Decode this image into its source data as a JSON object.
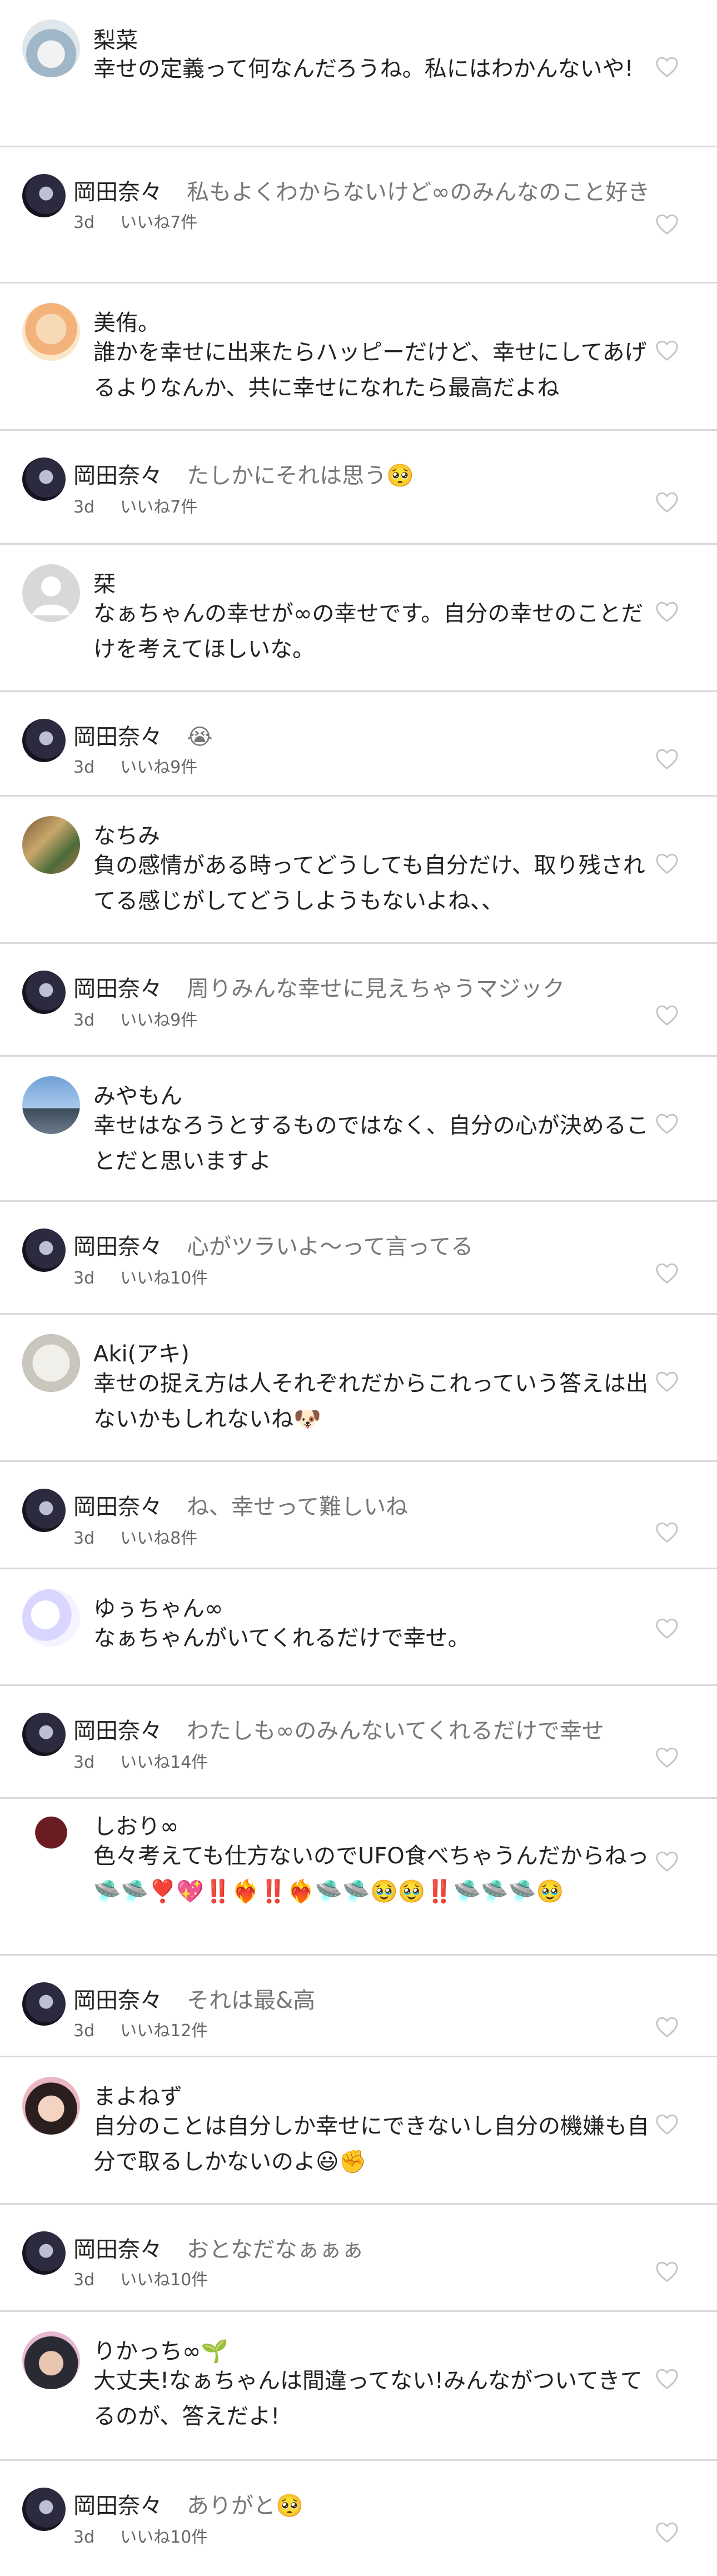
{
  "comments": [
    {
      "type": "comment",
      "name": "梨菜",
      "text": "幸せの定義って何なんだろうね。私にはわかんないや!",
      "avatar": "photo-girl"
    },
    {
      "type": "reply",
      "name": "岡田奈々",
      "text": "私もよくわからないけど∞のみんなのこと好き",
      "time": "3d",
      "likes": "いいね7件"
    },
    {
      "type": "comment",
      "name": "美侑。",
      "text": "誰かを幸せに出来たらハッピーだけど、幸せにしてあげるよりなんか、共に幸せになれたら最高だよね",
      "avatar": "photo-illustration"
    },
    {
      "type": "reply",
      "name": "岡田奈々",
      "text": "たしかにそれは思う🥺",
      "time": "3d",
      "likes": "いいね7件"
    },
    {
      "type": "comment",
      "name": "栞",
      "text": "なぁちゃんの幸せが∞の幸せです。自分の幸せのことだけを考えてほしいな。",
      "avatar": "default-user-icon"
    },
    {
      "type": "reply",
      "name": "岡田奈々",
      "text": "😭",
      "time": "3d",
      "likes": "いいね9件"
    },
    {
      "type": "comment",
      "name": "なちみ",
      "text": "負の感情がある時ってどうしても自分だけ、取り残されてる感じがしてどうしようもないよね、、",
      "avatar": "photo-group"
    },
    {
      "type": "reply",
      "name": "岡田奈々",
      "text": "周りみんな幸せに見えちゃうマジック",
      "time": "3d",
      "likes": "いいね9件"
    },
    {
      "type": "comment",
      "name": "みやもん",
      "text": "幸せはなろうとするものではなく、自分の心が決めることだと思いますよ",
      "avatar": "photo-tower"
    },
    {
      "type": "reply",
      "name": "岡田奈々",
      "text": "心がツラいよ〜って言ってる",
      "time": "3d",
      "likes": "いいね10件"
    },
    {
      "type": "comment",
      "name": "Aki(アキ)",
      "text": "幸せの捉え方は人それぞれだからこれっていう答えは出ないかもしれないね🐶",
      "avatar": "photo-dog"
    },
    {
      "type": "reply",
      "name": "岡田奈々",
      "text": "ね、幸せって難しいね",
      "time": "3d",
      "likes": "いいね8件"
    },
    {
      "type": "comment",
      "name": "ゆぅちゃん∞",
      "text": "なぁちゃんがいてくれるだけで幸せ。",
      "avatar": "photo-moon"
    },
    {
      "type": "reply",
      "name": "岡田奈々",
      "text": "わたしも∞のみんないてくれるだけで幸せ",
      "time": "3d",
      "likes": "いいね14件"
    },
    {
      "type": "comment",
      "name": "しおり∞",
      "text": "色々考えても仕方ないのでUFO食べちゃうんだからねっ🛸🛸❣️💖‼️❤️‍🔥‼️❤️‍🔥🛸🛸🥹🥹‼️🛸🛸🛸🥹",
      "avatar": "photo-pixel-art"
    },
    {
      "type": "reply",
      "name": "岡田奈々",
      "text": "それは最&高",
      "time": "3d",
      "likes": "いいね12件"
    },
    {
      "type": "comment",
      "name": "まよねず",
      "text": "自分のことは自分しか幸せにできないし自分の機嫌も自分で取るしかないのよ😃✊",
      "avatar": "photo-anime"
    },
    {
      "type": "reply",
      "name": "岡田奈々",
      "text": "おとなだなぁぁぁ",
      "time": "3d",
      "likes": "いいね10件"
    },
    {
      "type": "comment",
      "name": "りかっち∞🌱",
      "text": "大丈夫!なぁちゃんは間違ってない!みんながついてきてるのが、答えだよ!",
      "avatar": "photo-person"
    },
    {
      "type": "reply",
      "name": "岡田奈々",
      "text": "ありがと🥺",
      "time": "3d",
      "likes": "いいね10件"
    }
  ],
  "colors": {
    "divider": "#d9d9d9",
    "secondary_text": "#777777",
    "heart_outline": "#c4c4c4"
  },
  "icons": {
    "like": "heart-outline-icon",
    "reply_avatar": "avatar-okada"
  }
}
